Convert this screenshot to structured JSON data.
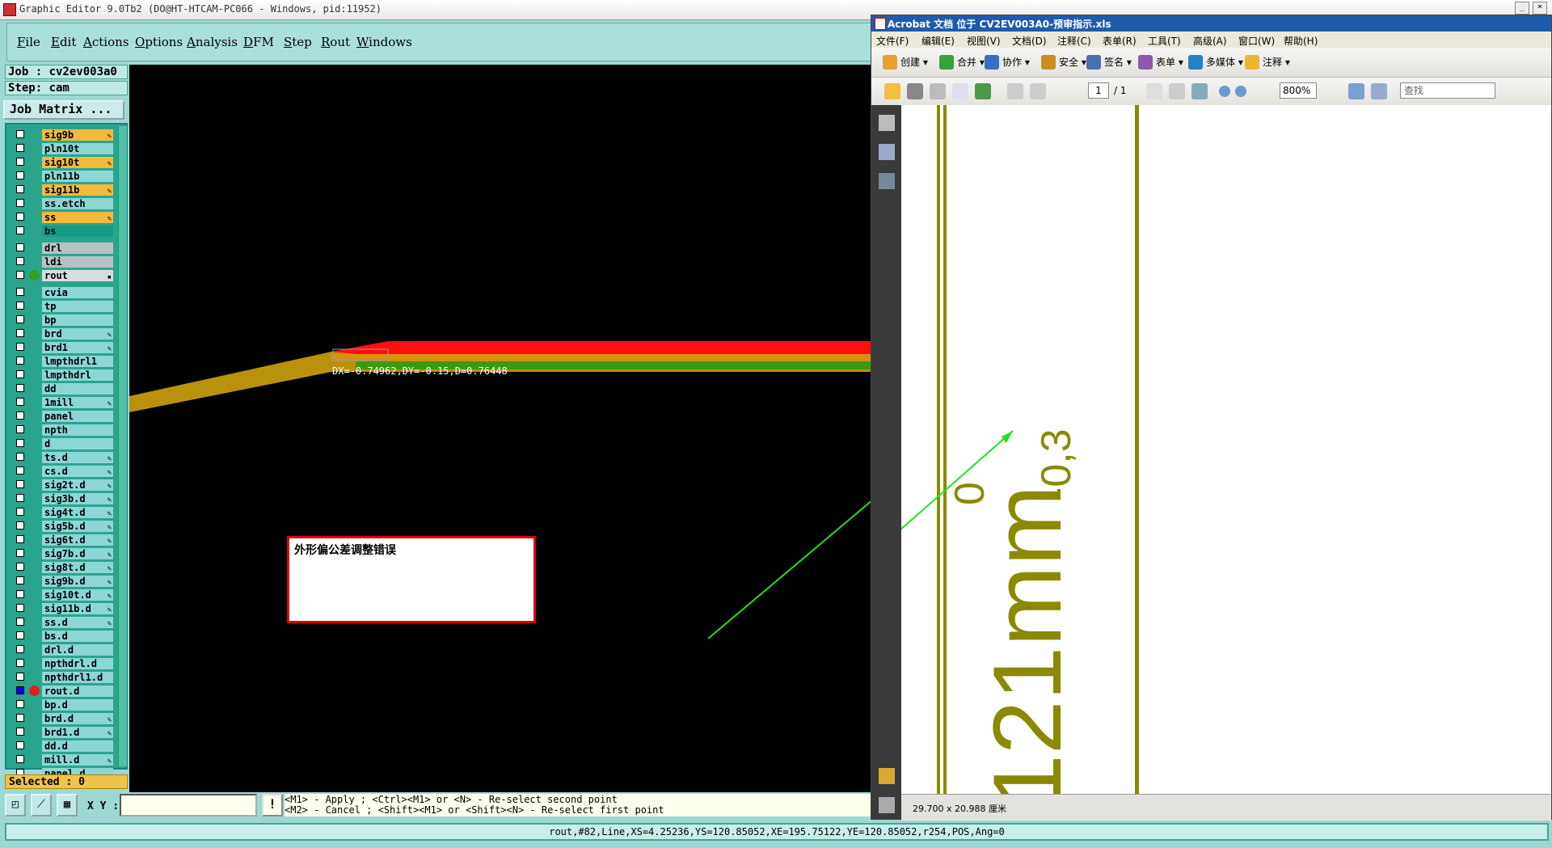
{
  "graphic_editor": {
    "title": "Graphic Editor 9.0Tb2 (DO@HT-HTCAM-PC066 - Windows, pid:11952)",
    "menu": [
      "File",
      "Edit",
      "Actions",
      "Options",
      "Analysis",
      "DFM",
      "Step",
      "Rout",
      "Windows"
    ],
    "job": "Job : cv2ev003a0",
    "step": "Step: cam",
    "job_matrix_button": "Job Matrix ...",
    "layers": [
      {
        "name": "sig9b",
        "style": "orange",
        "mark": "✎"
      },
      {
        "name": "pln10t",
        "style": "cyan",
        "mark": ""
      },
      {
        "name": "sig10t",
        "style": "orange",
        "mark": "✎"
      },
      {
        "name": "pln11b",
        "style": "cyan",
        "mark": ""
      },
      {
        "name": "sig11b",
        "style": "orange",
        "mark": "✎"
      },
      {
        "name": "ss.etch",
        "style": "cyan",
        "mark": ""
      },
      {
        "name": "ss",
        "style": "orange",
        "mark": "✎"
      },
      {
        "name": "bs",
        "style": "teal",
        "mark": ""
      },
      {
        "name": "drl",
        "style": "gray",
        "mark": ""
      },
      {
        "name": "ldi",
        "style": "gray",
        "mark": ""
      },
      {
        "name": "rout",
        "style": "light",
        "mark": "▪",
        "dot": "#3a9a2a"
      },
      {
        "name": "cvia",
        "style": "cyan",
        "mark": ""
      },
      {
        "name": "tp",
        "style": "cyan",
        "mark": ""
      },
      {
        "name": "bp",
        "style": "cyan",
        "mark": ""
      },
      {
        "name": "brd",
        "style": "cyan",
        "mark": "✎"
      },
      {
        "name": "brd1",
        "style": "cyan",
        "mark": "✎"
      },
      {
        "name": "lmpthdrl1",
        "style": "cyan",
        "mark": ""
      },
      {
        "name": "lmpthdrl",
        "style": "cyan",
        "mark": ""
      },
      {
        "name": "dd",
        "style": "cyan",
        "mark": ""
      },
      {
        "name": "1mill",
        "style": "cyan",
        "mark": "✎"
      },
      {
        "name": "panel",
        "style": "cyan",
        "mark": ""
      },
      {
        "name": "npth",
        "style": "cyan",
        "mark": ""
      },
      {
        "name": "d",
        "style": "cyan",
        "mark": ""
      },
      {
        "name": "ts.d",
        "style": "cyan",
        "mark": "✎"
      },
      {
        "name": "cs.d",
        "style": "cyan",
        "mark": "✎"
      },
      {
        "name": "sig2t.d",
        "style": "cyan",
        "mark": "✎"
      },
      {
        "name": "sig3b.d",
        "style": "cyan",
        "mark": "✎"
      },
      {
        "name": "sig4t.d",
        "style": "cyan",
        "mark": "✎"
      },
      {
        "name": "sig5b.d",
        "style": "cyan",
        "mark": "✎"
      },
      {
        "name": "sig6t.d",
        "style": "cyan",
        "mark": "✎"
      },
      {
        "name": "sig7b.d",
        "style": "cyan",
        "mark": "✎"
      },
      {
        "name": "sig8t.d",
        "style": "cyan",
        "mark": "✎"
      },
      {
        "name": "sig9b.d",
        "style": "cyan",
        "mark": "✎"
      },
      {
        "name": "sig10t.d",
        "style": "cyan",
        "mark": "✎"
      },
      {
        "name": "sig11b.d",
        "style": "cyan",
        "mark": "✎"
      },
      {
        "name": "ss.d",
        "style": "cyan",
        "mark": "✎"
      },
      {
        "name": "bs.d",
        "style": "cyan",
        "mark": ""
      },
      {
        "name": "drl.d",
        "style": "cyan",
        "mark": ""
      },
      {
        "name": "npthdrl.d",
        "style": "cyan",
        "mark": ""
      },
      {
        "name": "npthdrl1.d",
        "style": "cyan",
        "mark": ""
      },
      {
        "name": "rout.d",
        "style": "cyan",
        "mark": "",
        "dot": "#e02020",
        "selected": true
      },
      {
        "name": "bp.d",
        "style": "cyan",
        "mark": ""
      },
      {
        "name": "brd.d",
        "style": "cyan",
        "mark": "✎"
      },
      {
        "name": "brd1.d",
        "style": "cyan",
        "mark": "✎"
      },
      {
        "name": "dd.d",
        "style": "cyan",
        "mark": ""
      },
      {
        "name": "mill.d",
        "style": "cyan",
        "mark": "✎"
      },
      {
        "name": "panel.d",
        "style": "cyan",
        "mark": ""
      }
    ],
    "selected_count": "Selected : 0",
    "measure_label": "DX=-0.74962,DY=-0.15,D=0.76448",
    "annotation": "外形偏公差调整错误",
    "xy_label": "X Y :",
    "xy_value": "",
    "hint_line1": "<M1> - Apply  ; <Ctrl><M1> or <N> - Re-select second point",
    "hint_line2": "<M2> - Cancel ; <Shift><M1> or <Shift><N> - Re-select first point",
    "status": "rout,#82,Line,XS=4.25236,YS=120.85052,XE=195.75122,YE=120.85052,r254,POS,Ang=0"
  },
  "acrobat": {
    "title": "Acrobat 文档 位于 CV2EV003A0-预审指示.xls",
    "menu": [
      "文件(F)",
      "编辑(E)",
      "视图(V)",
      "文档(D)",
      "注释(C)",
      "表单(R)",
      "工具(T)",
      "高级(A)",
      "窗口(W)",
      "帮助(H)"
    ],
    "toolbar1": [
      {
        "label": "创建",
        "icon": "create-icon",
        "color": "#e8a030"
      },
      {
        "label": "合并",
        "icon": "combine-icon",
        "color": "#3aa040"
      },
      {
        "label": "协作",
        "icon": "collaborate-icon",
        "color": "#3a70c0"
      },
      {
        "label": "安全",
        "icon": "lock-icon",
        "color": "#c89020"
      },
      {
        "label": "签名",
        "icon": "pen-icon",
        "color": "#4a6fb0"
      },
      {
        "label": "表单",
        "icon": "form-icon",
        "color": "#8a5ab0"
      },
      {
        "label": "多媒体",
        "icon": "multimedia-icon",
        "color": "#2a80c0"
      },
      {
        "label": "注释",
        "icon": "comment-icon",
        "color": "#e8b830"
      }
    ],
    "page_current": "1",
    "page_total": "/ 1",
    "zoom": "800%",
    "find_placeholder": "查找",
    "page_size": "29.700 x 20.988 厘米",
    "doc_text_main": "121mm",
    "doc_text_sup": "0",
    "doc_text_sub": "-0,3",
    "colors": {
      "olive": "#8a8a00",
      "arrow": "#20e020"
    }
  }
}
